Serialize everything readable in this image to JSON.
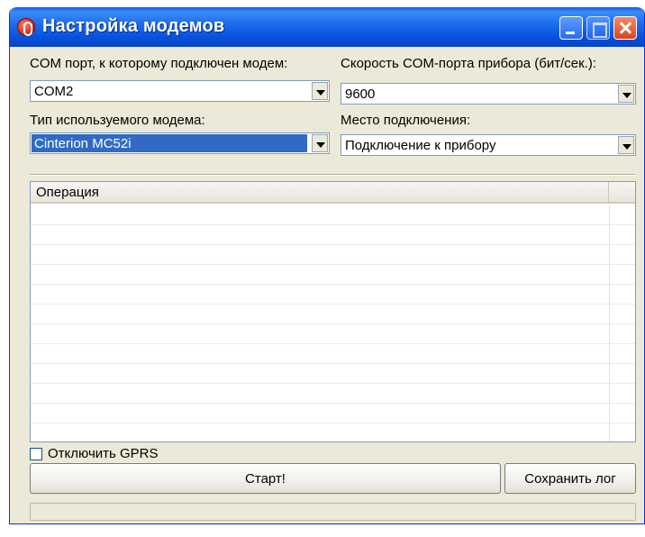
{
  "window": {
    "title": "Настройка модемов",
    "icon": "modem-app-icon"
  },
  "form": {
    "com_port_label": "COM порт, к которому подключен модем:",
    "com_port_value": "COM2",
    "com_speed_label": "Скорость COM-порта прибора (бит/сек.):",
    "com_speed_value": "9600",
    "modem_type_label": "Тип используемого модема:",
    "modem_type_value": "Cinterion MC52i",
    "connection_place_label": "Место подключения:",
    "connection_place_value": "Подключение к прибору"
  },
  "log": {
    "columns": [
      "Операция",
      ""
    ],
    "rows": []
  },
  "options": {
    "disable_gprs_label": "Отключить GPRS",
    "disable_gprs_checked": false
  },
  "actions": {
    "start_label": "Старт!",
    "save_log_label": "Сохранить лог"
  },
  "colors": {
    "titlebar": "#0a5fe8",
    "window_bg": "#ece9d8",
    "selection": "#316ac5"
  }
}
